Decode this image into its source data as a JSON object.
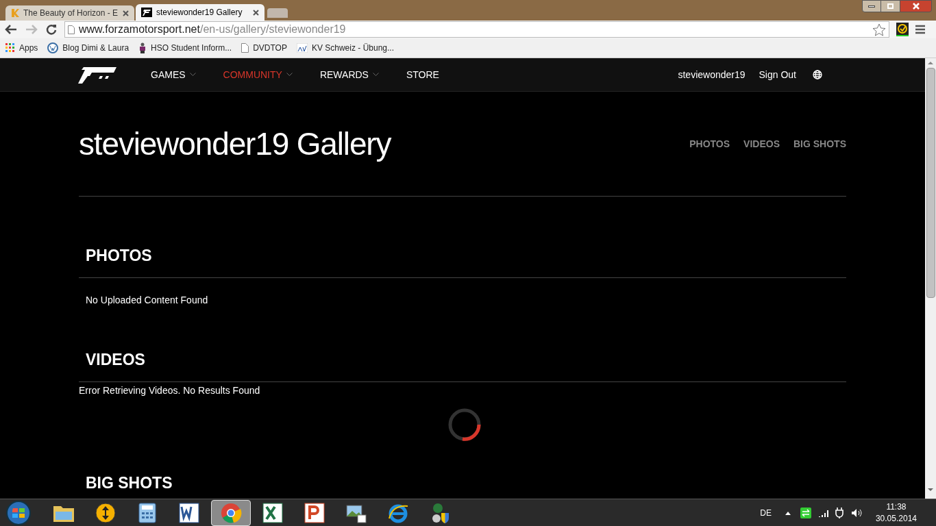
{
  "browser": {
    "tabs": [
      {
        "title": "The Beauty of Horizon - E",
        "selected": false
      },
      {
        "title": "steviewonder19 Gallery",
        "selected": true
      }
    ],
    "address": {
      "domain": "www.forzamotorsport.net",
      "path": "/en-us/gallery/steviewonder19"
    },
    "bookmarks": [
      {
        "label": "Apps"
      },
      {
        "label": "Blog Dimi & Laura"
      },
      {
        "label": "HSO Student Inform..."
      },
      {
        "label": "DVDTOP"
      },
      {
        "label": "KV Schweiz - Übung..."
      }
    ]
  },
  "site_nav": {
    "items": [
      {
        "label": "GAMES",
        "dropdown": true,
        "selected": false
      },
      {
        "label": "COMMUNITY",
        "dropdown": true,
        "selected": true
      },
      {
        "label": "REWARDS",
        "dropdown": true,
        "selected": false
      },
      {
        "label": "STORE",
        "dropdown": false,
        "selected": false
      }
    ],
    "user": "steviewonder19",
    "sign_out": "Sign Out"
  },
  "gallery": {
    "title": "steviewonder19 Gallery",
    "links": [
      "PHOTOS",
      "VIDEOS",
      "BIG SHOTS"
    ],
    "sections": [
      {
        "heading": "PHOTOS",
        "message": "No Uploaded Content Found",
        "kind": "empty"
      },
      {
        "heading": "VIDEOS",
        "message": "Error Retrieving Videos. No Results Found",
        "kind": "error"
      },
      {
        "heading": "BIG SHOTS",
        "kind": "cut"
      }
    ]
  },
  "taskbar": {
    "apps": [
      {
        "selected": false
      },
      {
        "selected": false
      },
      {
        "selected": false
      },
      {
        "selected": false
      },
      {
        "selected": true
      },
      {
        "selected": false
      },
      {
        "selected": false
      },
      {
        "selected": false
      },
      {
        "selected": false
      },
      {
        "selected": false
      }
    ],
    "language": "DE",
    "time": "11:38",
    "date": "30.05.2014"
  }
}
